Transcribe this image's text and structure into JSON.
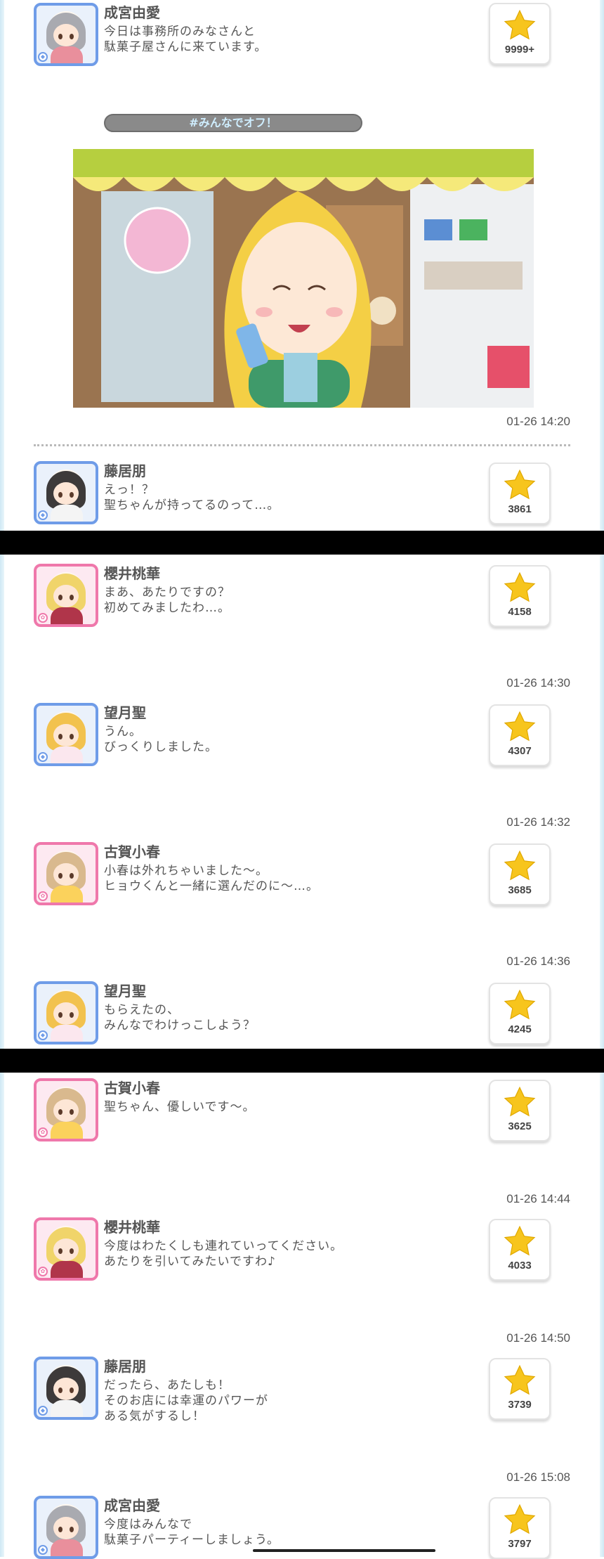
{
  "colors": {
    "blue_border": "#6f9ce8",
    "pink_border": "#ef78ab",
    "star": "#f7c51d",
    "tag_text": "#cfeeff"
  },
  "top_post": {
    "name": "成宮由愛",
    "text": "今日は事務所のみなさんと\n駄菓子屋さんに来ています。",
    "likes": "9999+",
    "hashtag": "#みんなでオフ！",
    "timestamp": "01-26 14:20"
  },
  "posts": [
    {
      "name": "藤居朋",
      "text": "えっ！？\n聖ちゃんが持ってるのって…。",
      "likes": "3861",
      "timestamp": ""
    },
    {
      "name": "櫻井桃華",
      "text": "まあ、あたりですの？\n初めてみましたわ…。",
      "likes": "4158",
      "timestamp": "01-26 14:30"
    },
    {
      "name": "望月聖",
      "text": "うん。\nびっくりしました。",
      "likes": "4307",
      "timestamp": "01-26 14:32"
    },
    {
      "name": "古賀小春",
      "text": "小春は外れちゃいました〜。\nヒョウくんと一緒に選んだのに〜…。",
      "likes": "3685",
      "timestamp": "01-26 14:36"
    },
    {
      "name": "望月聖",
      "text": "もらえたの、\nみんなでわけっこしよう？",
      "likes": "4245",
      "timestamp": ""
    },
    {
      "name": "古賀小春",
      "text": "聖ちゃん、優しいです〜。",
      "likes": "3625",
      "timestamp": "01-26 14:44"
    },
    {
      "name": "櫻井桃華",
      "text": "今度はわたくしも連れていってください。\nあたりを引いてみたいですわ♪",
      "likes": "4033",
      "timestamp": "01-26 14:50"
    },
    {
      "name": "藤居朋",
      "text": "だったら、あたしも！\nそのお店には幸運のパワーが\nある気がするし！",
      "likes": "3739",
      "timestamp": "01-26 15:08"
    },
    {
      "name": "成宮由愛",
      "text": "今度はみんなで\n駄菓子パーティーしましょう。",
      "likes": "3797",
      "timestamp": ""
    }
  ],
  "icons": {
    "like": "star-icon",
    "badge": "diamond-badge-icon"
  }
}
